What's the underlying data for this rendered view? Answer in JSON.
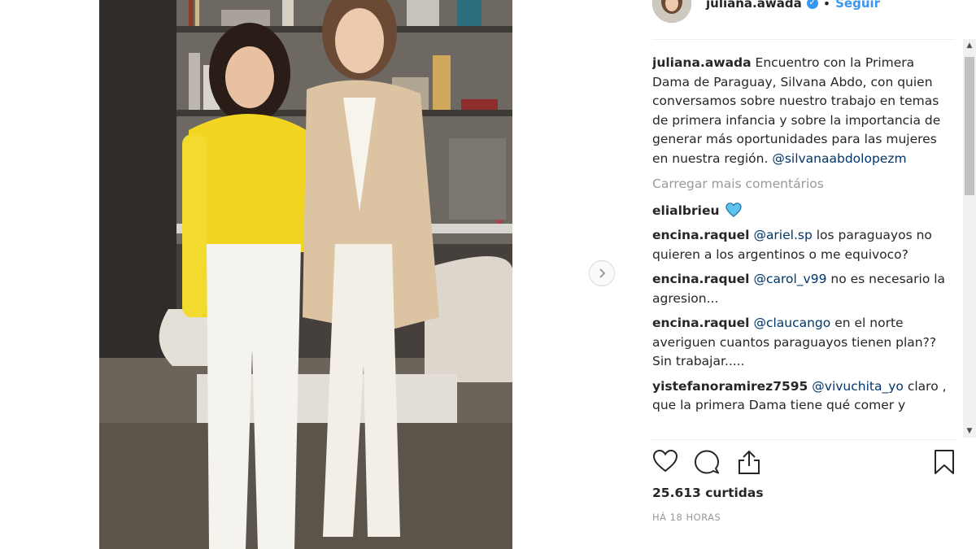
{
  "post": {
    "username": "juliana.awada",
    "follow_label": "Seguir",
    "separator": "•",
    "caption": "Encuentro con la Primera Dama de Paraguay, Silvana Abdo, con quien conversamos sobre nuestro trabajo en temas de primera infancia y sobre la importancia de generar más oportunidades para las mujeres en nuestra región.",
    "caption_mention": "@silvanaabdolopezm",
    "load_more": "Carregar mais comentários",
    "likes": "25.613 curtidas",
    "time": "HÁ 18 HORAS"
  },
  "comments": [
    {
      "user": "elialbrieu",
      "mention": "",
      "text": "",
      "emoji": "blue-heart"
    },
    {
      "user": "encina.raquel",
      "mention": "@ariel.sp",
      "text": "los paraguayos no quieren a los argentinos o me equivoco?"
    },
    {
      "user": "encina.raquel",
      "mention": "@carol_v99",
      "text": "no es necesario la agresion..."
    },
    {
      "user": "encina.raquel",
      "mention": "@claucango",
      "text": "en el norte averiguen cuantos paraguayos tienen plan?? Sin trabajar....."
    },
    {
      "user": "yistefanoramirez7595",
      "mention": "@vivuchita_yo",
      "text": "claro , que la primera Dama tiene qué comer y"
    }
  ],
  "icons": {
    "like": "heart-icon",
    "comment": "comment-bubble-icon",
    "share": "share-icon",
    "save": "bookmark-icon",
    "next": "chevron-right-icon",
    "verified": "verified-badge-icon"
  },
  "colors": {
    "link": "#3897f0",
    "mention": "#003569",
    "muted": "#999999",
    "text": "#262626"
  }
}
